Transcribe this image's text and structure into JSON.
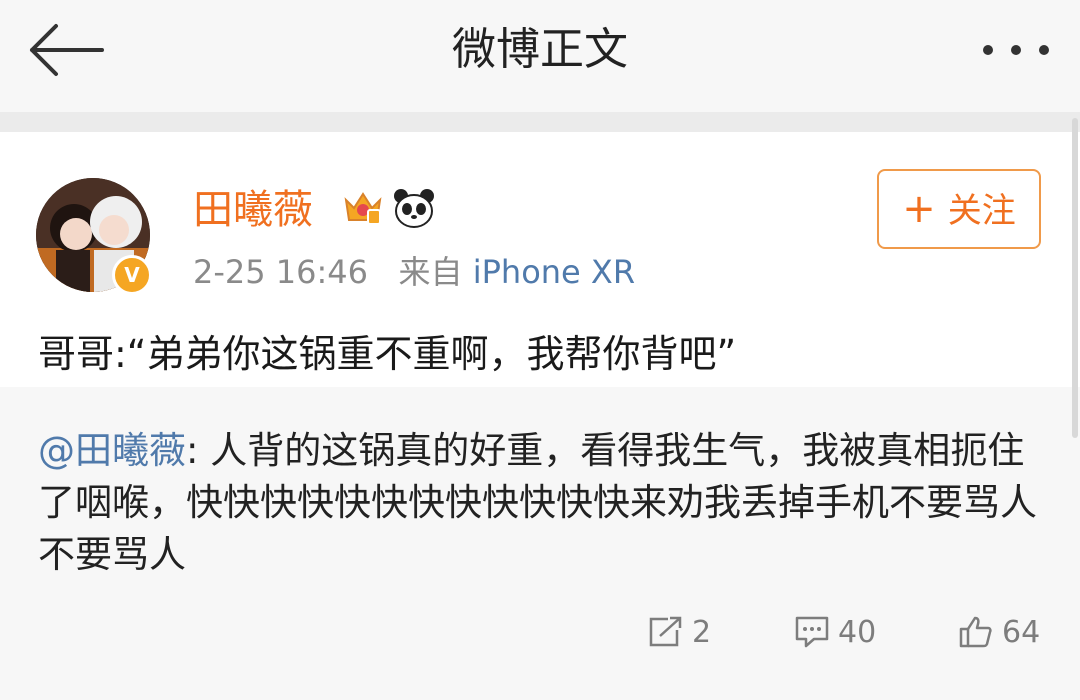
{
  "header": {
    "title": "微博正文",
    "back_icon": "arrow-left-icon",
    "more_icon": "more-dots-icon"
  },
  "post": {
    "author": {
      "name": "田曦薇",
      "verified_badge": "V",
      "badges": [
        "crown-icon",
        "panda-icon"
      ]
    },
    "meta": {
      "time": "2-25 16:46",
      "source_prefix": "来自",
      "source": "iPhone XR"
    },
    "follow_button": {
      "plus": "+",
      "label": "关注"
    },
    "content": "哥哥:“弟弟你这锅重不重啊，我帮你背吧”"
  },
  "repost": {
    "mention": "@田曦薇",
    "colon": ": ",
    "text": "人背的这锅真的好重，看得我生气，我被真相扼住了咽喉，快快快快快快快快快快快快来劝我丢掉手机不要骂人不要骂人"
  },
  "actions": {
    "share": {
      "icon": "share-icon",
      "count": "2"
    },
    "comment": {
      "icon": "comment-icon",
      "count": "40"
    },
    "like": {
      "icon": "thumbs-up-icon",
      "count": "64"
    }
  },
  "colors": {
    "accent": "#f07020",
    "link": "#507aab",
    "badge": "#f5a623"
  }
}
